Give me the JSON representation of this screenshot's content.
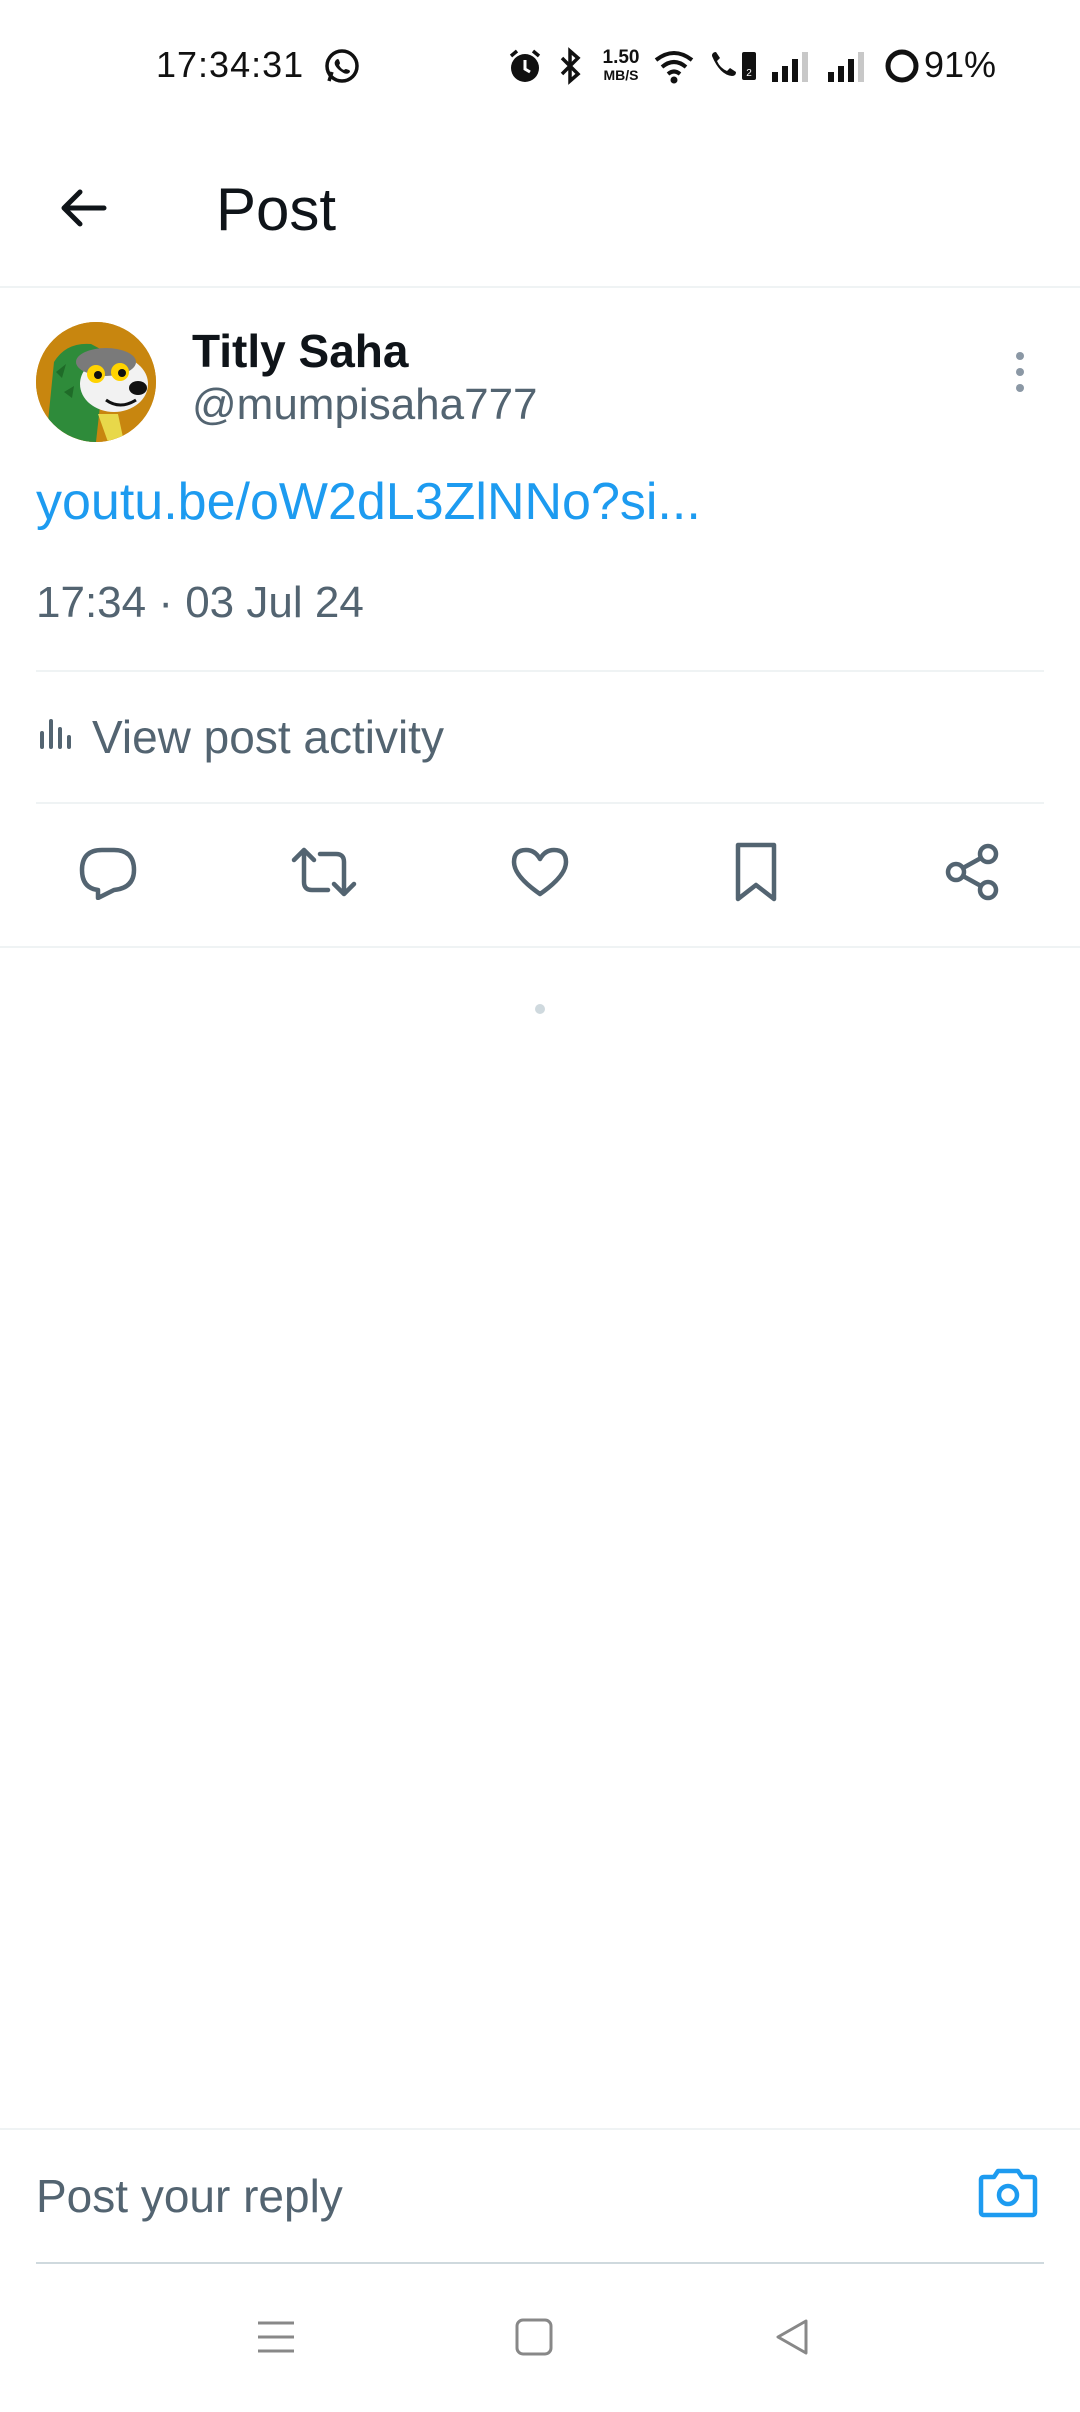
{
  "status_bar": {
    "time": "17:34:31",
    "net_speed_value": "1.50",
    "net_speed_unit": "MB/S",
    "battery_percent": "91%",
    "icons": [
      "whatsapp-icon",
      "alarm-icon",
      "bluetooth-icon",
      "wifi-icon",
      "volte-call-icon",
      "signal-icon",
      "signal-icon",
      "battery-ring-icon"
    ]
  },
  "header": {
    "title": "Post",
    "back_icon": "arrow-left-icon"
  },
  "post": {
    "display_name": "Titly Saha",
    "username": "@mumpisaha777",
    "link_text": "youtu.be/oW2dL3ZlNNo?si...",
    "timestamp": "17:34 · 03 Jul 24",
    "activity_label": "View post activity",
    "more_icon": "more-vertical-icon"
  },
  "actions": [
    {
      "name": "reply",
      "icon": "reply-bubble-icon"
    },
    {
      "name": "repost",
      "icon": "repost-icon"
    },
    {
      "name": "like",
      "icon": "heart-icon"
    },
    {
      "name": "bookmark",
      "icon": "bookmark-icon"
    },
    {
      "name": "share",
      "icon": "share-icon"
    }
  ],
  "reply": {
    "placeholder": "Post your reply",
    "camera_icon": "camera-icon"
  },
  "colors": {
    "accent": "#1d9bf0",
    "text_primary": "#0f1419",
    "text_secondary": "#536471",
    "divider": "#eff3f4"
  }
}
